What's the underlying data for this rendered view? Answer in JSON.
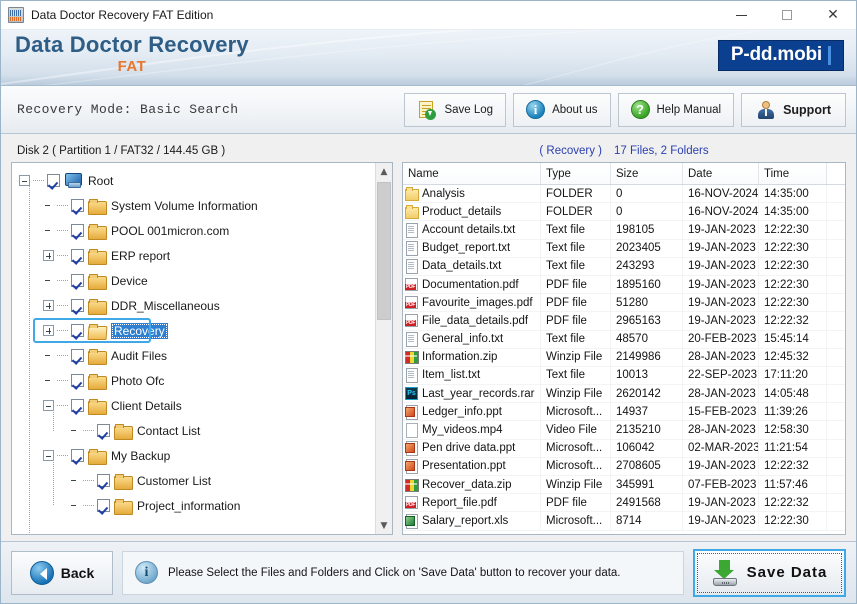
{
  "window": {
    "title": "Data Doctor Recovery FAT Edition",
    "icon": "app-icon",
    "minimize": "minimize-icon",
    "maximize": "maximize-icon",
    "close": "close-icon"
  },
  "brand": {
    "title": "Data Doctor Recovery",
    "subtitle": "FAT",
    "logo": "P-dd.mobi",
    "title_color": "#2e5d86",
    "subtitle_color": "#e8762c",
    "logo_bg": "#0b3f8f"
  },
  "toolbar": {
    "mode_text": "Recovery Mode: Basic Search",
    "buttons": [
      {
        "label": "Save Log",
        "icon": "save-log-icon"
      },
      {
        "label": "About us",
        "icon": "info-icon"
      },
      {
        "label": "Help Manual",
        "icon": "question-icon"
      },
      {
        "label": "Support",
        "icon": "support-person-icon"
      }
    ]
  },
  "left_pane": {
    "disk_label": "Disk 2 ( Partition 1 / FAT32 / 144.45 GB )",
    "tree": [
      {
        "label": "Root",
        "indent": 0,
        "expander": "minus",
        "checked": true,
        "icon": "computer-icon",
        "selected": false
      },
      {
        "label": "System Volume Information",
        "indent": 1,
        "expander": "none",
        "checked": true,
        "icon": "folder-icon",
        "selected": false
      },
      {
        "label": "POOL 001micron.com",
        "indent": 1,
        "expander": "none",
        "checked": true,
        "icon": "folder-icon",
        "selected": false
      },
      {
        "label": "ERP report",
        "indent": 1,
        "expander": "plus",
        "checked": true,
        "icon": "folder-icon",
        "selected": false
      },
      {
        "label": "Device",
        "indent": 1,
        "expander": "none",
        "checked": true,
        "icon": "folder-icon",
        "selected": false
      },
      {
        "label": "DDR_Miscellaneous",
        "indent": 1,
        "expander": "plus",
        "checked": true,
        "icon": "folder-icon",
        "selected": false
      },
      {
        "label": "Recovery",
        "indent": 1,
        "expander": "plus",
        "checked": true,
        "icon": "folder-open-icon",
        "selected": true
      },
      {
        "label": "Audit Files",
        "indent": 1,
        "expander": "none",
        "checked": true,
        "icon": "folder-icon",
        "selected": false
      },
      {
        "label": "Photo Ofc",
        "indent": 1,
        "expander": "none",
        "checked": true,
        "icon": "folder-icon",
        "selected": false
      },
      {
        "label": "Client Details",
        "indent": 1,
        "expander": "minus",
        "checked": true,
        "icon": "folder-icon",
        "selected": false
      },
      {
        "label": "Contact List",
        "indent": 2,
        "expander": "none",
        "checked": true,
        "icon": "folder-icon",
        "selected": false
      },
      {
        "label": "My Backup",
        "indent": 1,
        "expander": "minus",
        "checked": true,
        "icon": "folder-icon",
        "selected": false
      },
      {
        "label": "Customer List",
        "indent": 2,
        "expander": "none",
        "checked": true,
        "icon": "folder-icon",
        "selected": false
      },
      {
        "label": "Project_information",
        "indent": 2,
        "expander": "none",
        "checked": true,
        "icon": "folder-icon",
        "selected": false
      }
    ],
    "scroll": {
      "up": "chevron-up-icon",
      "down": "chevron-down-icon"
    }
  },
  "right_pane": {
    "folder_label": "( Recovery )",
    "count_label": "17 Files, 2 Folders",
    "columns": [
      "Name",
      "Type",
      "Size",
      "Date",
      "Time"
    ],
    "rows": [
      {
        "icon": "folder-icon",
        "name": "Analysis",
        "type": "FOLDER",
        "size": "0",
        "date": "16-NOV-2024",
        "time": "14:35:00"
      },
      {
        "icon": "folder-icon",
        "name": "Product_details",
        "type": "FOLDER",
        "size": "0",
        "date": "16-NOV-2024",
        "time": "14:35:00"
      },
      {
        "icon": "txt-icon",
        "name": "Account details.txt",
        "type": "Text file",
        "size": "198105",
        "date": "19-JAN-2023",
        "time": "12:22:30"
      },
      {
        "icon": "txt-icon",
        "name": "Budget_report.txt",
        "type": "Text file",
        "size": "2023405",
        "date": "19-JAN-2023",
        "time": "12:22:30"
      },
      {
        "icon": "txt-icon",
        "name": "Data_details.txt",
        "type": "Text file",
        "size": "243293",
        "date": "19-JAN-2023",
        "time": "12:22:30"
      },
      {
        "icon": "pdf-icon",
        "name": "Documentation.pdf",
        "type": "PDF file",
        "size": "1895160",
        "date": "19-JAN-2023",
        "time": "12:22:30"
      },
      {
        "icon": "pdf-icon",
        "name": "Favourite_images.pdf",
        "type": "PDF file",
        "size": "51280",
        "date": "19-JAN-2023",
        "time": "12:22:30"
      },
      {
        "icon": "pdf-icon",
        "name": "File_data_details.pdf",
        "type": "PDF file",
        "size": "2965163",
        "date": "19-JAN-2023",
        "time": "12:22:32"
      },
      {
        "icon": "txt-icon",
        "name": "General_info.txt",
        "type": "Text file",
        "size": "48570",
        "date": "20-FEB-2023",
        "time": "15:45:14"
      },
      {
        "icon": "zip-icon",
        "name": "Information.zip",
        "type": "Winzip File",
        "size": "2149986",
        "date": "28-JAN-2023",
        "time": "12:45:32"
      },
      {
        "icon": "txt-icon",
        "name": "Item_list.txt",
        "type": "Text file",
        "size": "10013",
        "date": "22-SEP-2023",
        "time": "17:11:20"
      },
      {
        "icon": "psd-icon",
        "name": "Last_year_records.rar",
        "type": "Winzip File",
        "size": "2620142",
        "date": "28-JAN-2023",
        "time": "14:05:48"
      },
      {
        "icon": "ppt-icon",
        "name": "Ledger_info.ppt",
        "type": "Microsoft...",
        "size": "14937",
        "date": "15-FEB-2023",
        "time": "11:39:26"
      },
      {
        "icon": "blank-icon",
        "name": "My_videos.mp4",
        "type": "Video File",
        "size": "2135210",
        "date": "28-JAN-2023",
        "time": "12:58:30"
      },
      {
        "icon": "ppt-icon",
        "name": "Pen drive data.ppt",
        "type": "Microsoft...",
        "size": "106042",
        "date": "02-MAR-2023",
        "time": "11:21:54"
      },
      {
        "icon": "ppt-icon",
        "name": "Presentation.ppt",
        "type": "Microsoft...",
        "size": "2708605",
        "date": "19-JAN-2023",
        "time": "12:22:32"
      },
      {
        "icon": "zip-icon",
        "name": "Recover_data.zip",
        "type": "Winzip File",
        "size": "345991",
        "date": "07-FEB-2023",
        "time": "11:57:46"
      },
      {
        "icon": "pdf-icon",
        "name": "Report_file.pdf",
        "type": "PDF file",
        "size": "2491568",
        "date": "19-JAN-2023",
        "time": "12:22:32"
      },
      {
        "icon": "xls-icon",
        "name": "Salary_report.xls",
        "type": "Microsoft...",
        "size": "8714",
        "date": "19-JAN-2023",
        "time": "12:22:30"
      }
    ]
  },
  "footer": {
    "back_label": "Back",
    "back_icon": "back-arrow-icon",
    "status_icon": "info-icon",
    "status_text": "Please Select the Files and Folders and Click on 'Save Data' button to recover your data.",
    "save_label": "Save  Data",
    "save_icon": "save-download-icon",
    "save_highlight_color": "#3fa9e8"
  }
}
